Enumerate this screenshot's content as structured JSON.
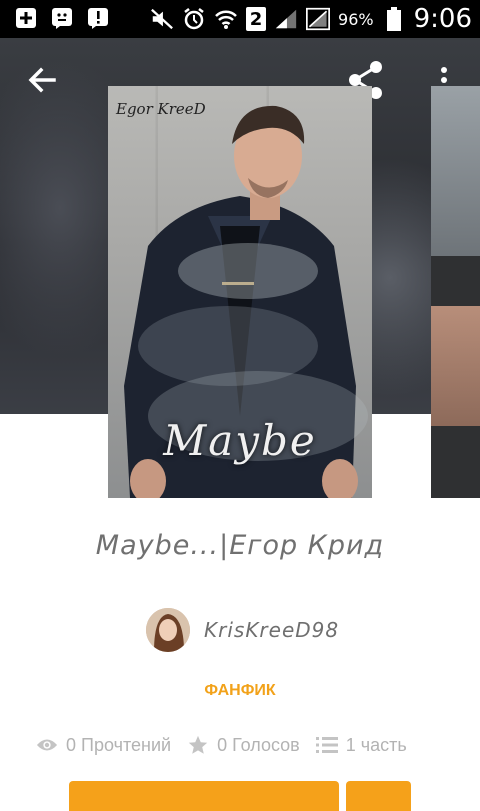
{
  "status_bar": {
    "battery_percent": "96%",
    "time": "9:06",
    "sim_slot": "2",
    "icons": [
      "plus-icon",
      "emoji-icon",
      "alert-icon",
      "mute-icon",
      "alarm-icon",
      "wifi-icon",
      "signal-icon",
      "battery-icon"
    ]
  },
  "toolbar": {
    "back_icon": "arrow-back-icon",
    "share_icon": "share-icon",
    "more_icon": "more-vert-icon"
  },
  "cover": {
    "author_text": "Egor KreeD",
    "title_text": "Maybe"
  },
  "story": {
    "title": "Maybe...|Егор Крид",
    "author": "KrisKreeD98",
    "genre": "ФАНФИК"
  },
  "stats": {
    "reads": "0 Прочтений",
    "votes": "0 Голосов",
    "parts": "1 часть"
  },
  "colors": {
    "accent": "#f5a11a",
    "genre": "#f2a21a",
    "text_muted": "#b3b3b3"
  }
}
